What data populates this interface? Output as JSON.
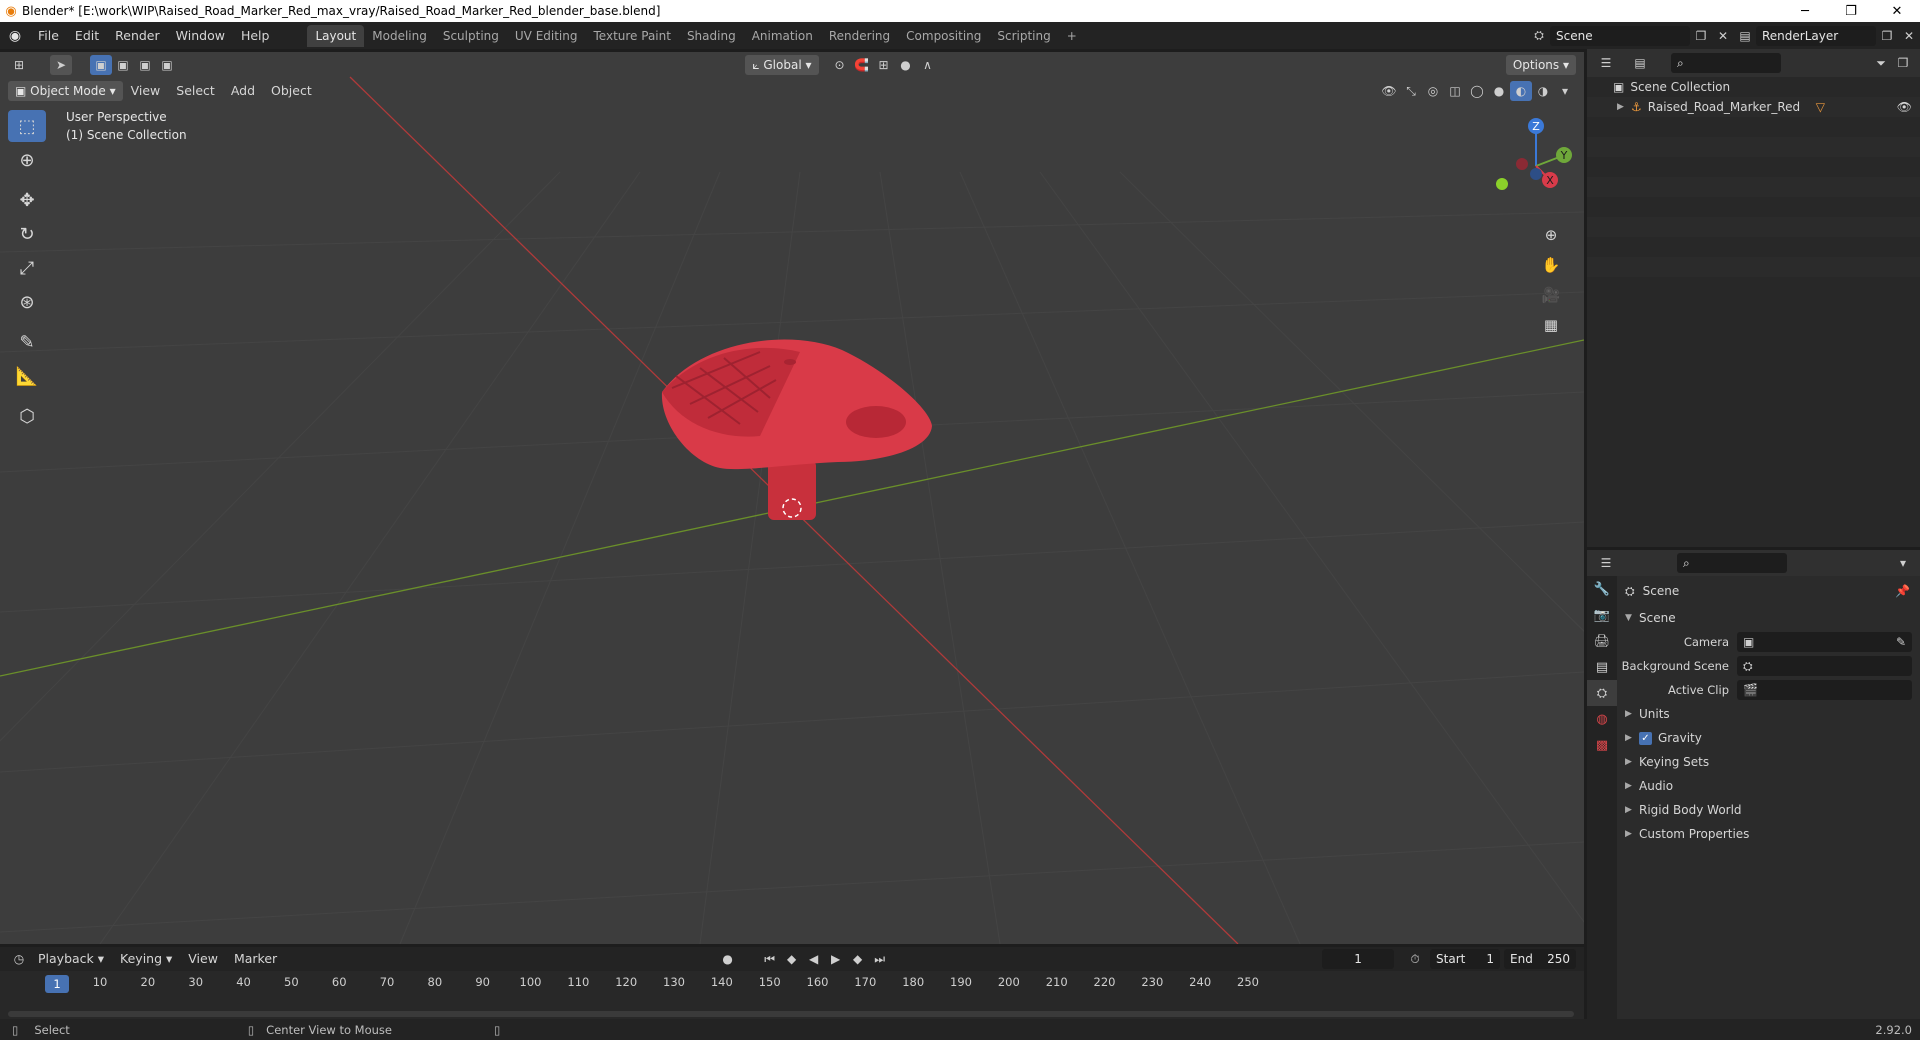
{
  "window": {
    "title": "Blender* [E:\\work\\WIP\\Raised_Road_Marker_Red_max_vray/Raised_Road_Marker_Red_blender_base.blend]",
    "controls": [
      "─",
      "❐",
      "✕"
    ]
  },
  "menu": {
    "items": [
      "File",
      "Edit",
      "Render",
      "Window",
      "Help"
    ]
  },
  "workspaces": {
    "tabs": [
      "Layout",
      "Modeling",
      "Sculpting",
      "UV Editing",
      "Texture Paint",
      "Shading",
      "Animation",
      "Rendering",
      "Compositing",
      "Scripting"
    ],
    "active": "Layout",
    "add": "+"
  },
  "scene_selector": {
    "value": "Scene"
  },
  "view_layer_selector": {
    "value": "RenderLayer"
  },
  "viewport": {
    "mode": "Object Mode",
    "menus": [
      "View",
      "Select",
      "Add",
      "Object"
    ],
    "orientation": "Global",
    "options_label": "Options",
    "info_line1": "User Perspective",
    "info_line2": "(1) Scene Collection",
    "object_color": "#e0404f",
    "gizmo": {
      "z": "Z",
      "y": "Y",
      "x": "X"
    }
  },
  "outliner": {
    "root": "Scene Collection",
    "items": [
      {
        "name": "Raised_Road_Marker_Red"
      }
    ]
  },
  "properties": {
    "header": "Scene",
    "section": "Scene",
    "fields": [
      {
        "label": "Camera"
      },
      {
        "label": "Background Scene"
      },
      {
        "label": "Active Clip"
      }
    ],
    "panels": [
      "Units",
      "Gravity",
      "Keying Sets",
      "Audio",
      "Rigid Body World",
      "Custom Properties"
    ],
    "gravity_checked": true
  },
  "timeline": {
    "menus": [
      "Playback",
      "Keying",
      "View",
      "Marker"
    ],
    "current_frame": "1",
    "start_label": "Start",
    "start": "1",
    "end_label": "End",
    "end": "250",
    "ticks": [
      "10",
      "20",
      "30",
      "40",
      "50",
      "60",
      "70",
      "80",
      "90",
      "100",
      "110",
      "120",
      "130",
      "140",
      "150",
      "160",
      "170",
      "180",
      "190",
      "200",
      "210",
      "220",
      "230",
      "240",
      "250"
    ],
    "cursor_label": "1"
  },
  "statusbar": {
    "left": "Select",
    "middle": "Center View to Mouse",
    "version": "2.92.0"
  }
}
